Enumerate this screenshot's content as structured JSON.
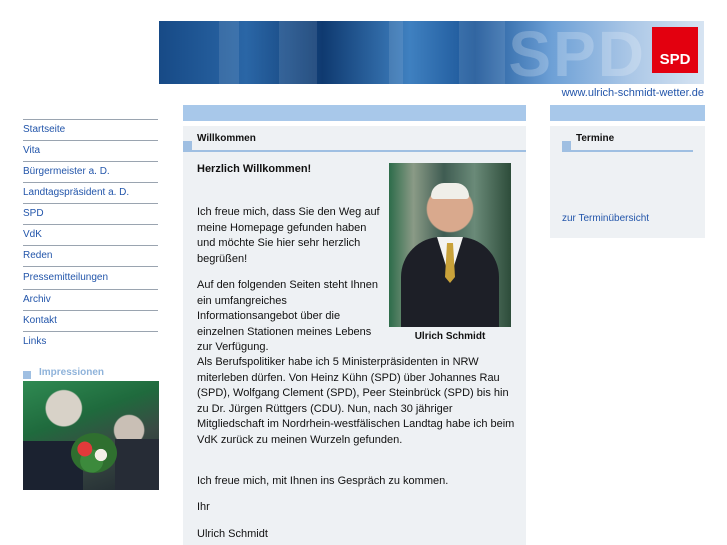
{
  "header": {
    "logo_text": "SPD",
    "url": "www.ulrich-schmidt-wetter.de"
  },
  "nav": {
    "items": [
      {
        "label": "Startseite"
      },
      {
        "label": "Vita"
      },
      {
        "label": "Bürgermeister a. D."
      },
      {
        "label": "Landtagspräsident a. D."
      },
      {
        "label": "SPD"
      },
      {
        "label": "VdK"
      },
      {
        "label": "Reden"
      },
      {
        "label": "Pressemitteilungen"
      },
      {
        "label": "Archiv"
      },
      {
        "label": "Kontakt"
      },
      {
        "label": "Links"
      }
    ]
  },
  "impressionen": {
    "title": "Impressionen"
  },
  "main": {
    "section_title": "Willkommen",
    "greeting": "Herzlich Willkommen!",
    "paragraph1": "Ich freue mich, dass Sie den Weg auf meine Homepage gefunden haben und möchte Sie hier sehr herzlich begrüßen!",
    "paragraph2": "Auf den folgenden Seiten steht Ihnen ein umfangreiches Informationsangebot über die einzelnen Stationen meines Lebens zur Verfügung.",
    "paragraph3": "Als Berufspolitiker habe ich 5 Ministerpräsidenten in NRW miterleben dürfen. Von Heinz Kühn (SPD) über Johannes Rau (SPD), Wolfgang Clement (SPD), Peer Steinbrück (SPD) bis hin zu Dr. Jürgen Rüttgers (CDU). Nun, nach 30 jähriger Mitgliedschaft im Nordrhein-westfälischen Landtag habe ich beim VdK zurück zu meinen Wurzeln gefunden.",
    "paragraph4": "Ich freue mich, mit Ihnen ins Gespräch zu kommen.",
    "closing": "Ihr",
    "signature": "Ulrich Schmidt",
    "photo_caption": "Ulrich Schmidt"
  },
  "sidebar_right": {
    "section_title": "Termine",
    "link": "zur Terminübersicht"
  },
  "colors": {
    "accent": "#a8c8ea",
    "link": "#2255aa",
    "panel": "#eef1f4",
    "spd_red": "#e3000f"
  }
}
